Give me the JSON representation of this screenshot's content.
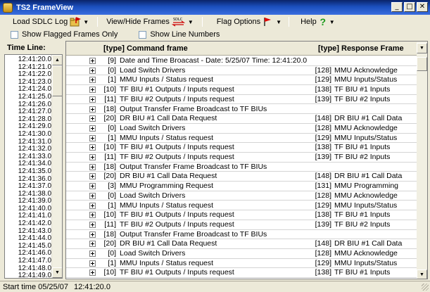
{
  "window": {
    "title": "TS2 FrameView",
    "min": "_",
    "max": "□",
    "close": "✕"
  },
  "toolbar": {
    "load_label": "Load SDLC Log",
    "view_label": "View/Hide Frames",
    "view_icon_text": "SDLC",
    "flag_label": "Flag Options",
    "help_label": "Help",
    "help_icon": "?",
    "drop": "▼"
  },
  "options": {
    "flagged_only": "Show Flagged Frames Only",
    "line_numbers": "Show Line Numbers"
  },
  "timeline": {
    "header": "Time Line:",
    "times": [
      "12:41:20.0",
      "12:41:21.0",
      "12:41:22.0",
      "12:41:23.0",
      "12:41:24.0",
      "12:41:25.0",
      "12:41:26.0",
      "12:41:27.0",
      "12:41:28.0",
      "12:41:29.0",
      "12:41:30.0",
      "12:41:31.0",
      "12:41:32.0",
      "12:41:33.0",
      "12:41:34.0",
      "12:41:35.0",
      "12:41:36.0",
      "12:41:37.0",
      "12:41:38.0",
      "12:41:39.0",
      "12:41:40.0",
      "12:41:41.0",
      "12:41:42.0",
      "12:41:43.0",
      "12:41:44.0",
      "12:41:45.0",
      "12:41:46.0",
      "12:41:47.0",
      "12:41:48.0",
      "12:41:49.0"
    ]
  },
  "frames": {
    "cmd_header": "[type] Command frame",
    "resp_header": "[type] Response Frame",
    "header_drop": "▼",
    "rows": [
      {
        "ct": "[9]",
        "c": "Date and Time Broacast - Date: 5/25/07  Time: 12:41:20.0",
        "rt": "",
        "r": ""
      },
      {
        "ct": "[0]",
        "c": "Load Switch Drivers",
        "rt": "[128]",
        "r": "MMU Acknowledge"
      },
      {
        "ct": "[1]",
        "c": "MMU Inputs / Status request",
        "rt": "[129]",
        "r": "MMU Inputs/Status"
      },
      {
        "ct": "[10]",
        "c": "TF BIU #1 Outputs / Inputs request",
        "rt": "[138]",
        "r": "TF BIU #1 Inputs"
      },
      {
        "ct": "[11]",
        "c": "TF BIU #2 Outputs / Inputs request",
        "rt": "[139]",
        "r": "TF BIU #2 Inputs"
      },
      {
        "ct": "[18]",
        "c": "Output Transfer Frame Broadcast to TF BIUs",
        "rt": "",
        "r": ""
      },
      {
        "ct": "[20]",
        "c": "DR BIU #1 Call Data Request",
        "rt": "[148]",
        "r": "DR BIU #1 Call Data"
      },
      {
        "ct": "[0]",
        "c": "Load Switch Drivers",
        "rt": "[128]",
        "r": "MMU Acknowledge"
      },
      {
        "ct": "[1]",
        "c": "MMU Inputs / Status request",
        "rt": "[129]",
        "r": "MMU Inputs/Status"
      },
      {
        "ct": "[10]",
        "c": "TF BIU #1 Outputs / Inputs request",
        "rt": "[138]",
        "r": "TF BIU #1 Inputs"
      },
      {
        "ct": "[11]",
        "c": "TF BIU #2 Outputs / Inputs request",
        "rt": "[139]",
        "r": "TF BIU #2 Inputs"
      },
      {
        "ct": "[18]",
        "c": "Output Transfer Frame Broadcast to TF BIUs",
        "rt": "",
        "r": ""
      },
      {
        "ct": "[20]",
        "c": "DR BIU #1 Call Data Request",
        "rt": "[148]",
        "r": "DR BIU #1 Call Data"
      },
      {
        "ct": "[3]",
        "c": "MMU Programming Request",
        "rt": "[131]",
        "r": "MMU Programming"
      },
      {
        "ct": "[0]",
        "c": "Load Switch Drivers",
        "rt": "[128]",
        "r": "MMU Acknowledge"
      },
      {
        "ct": "[1]",
        "c": "MMU Inputs / Status request",
        "rt": "[129]",
        "r": "MMU Inputs/Status"
      },
      {
        "ct": "[10]",
        "c": "TF BIU #1 Outputs / Inputs request",
        "rt": "[138]",
        "r": "TF BIU #1 Inputs"
      },
      {
        "ct": "[11]",
        "c": "TF BIU #2 Outputs / Inputs request",
        "rt": "[139]",
        "r": "TF BIU #2 Inputs"
      },
      {
        "ct": "[18]",
        "c": "Output Transfer Frame Broadcast to TF BIUs",
        "rt": "",
        "r": ""
      },
      {
        "ct": "[20]",
        "c": "DR BIU #1 Call Data Request",
        "rt": "[148]",
        "r": "DR BIU #1 Call Data"
      },
      {
        "ct": "[0]",
        "c": "Load Switch Drivers",
        "rt": "[128]",
        "r": "MMU Acknowledge"
      },
      {
        "ct": "[1]",
        "c": "MMU Inputs / Status request",
        "rt": "[129]",
        "r": "MMU Inputs/Status"
      },
      {
        "ct": "[10]",
        "c": "TF BIU #1 Outputs / Inputs request",
        "rt": "[138]",
        "r": "TF BIU #1 Inputs"
      }
    ]
  },
  "status": {
    "start_label": "Start time 05/25/07",
    "start_time": "12:41:20.0"
  },
  "icons": {
    "load": "folder-flag-icon",
    "view": "sdlc-arrows-icon",
    "flag": "red-flag-icon",
    "help": "help-icon"
  }
}
